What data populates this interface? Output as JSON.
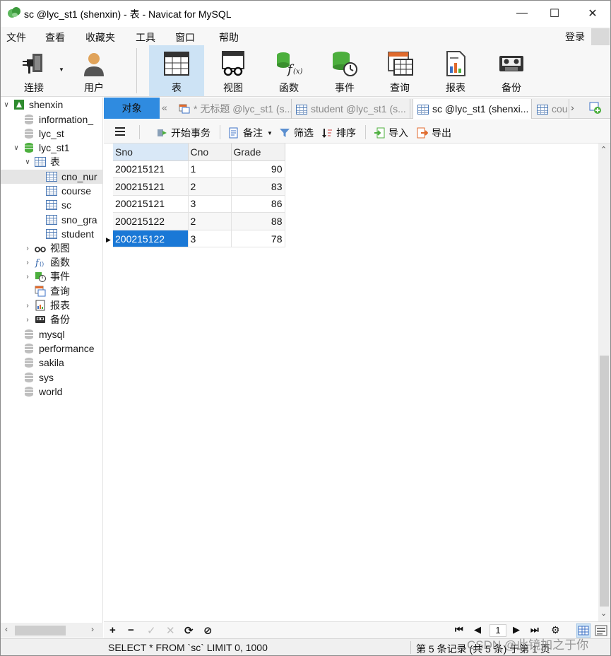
{
  "window": {
    "title": "sc @lyc_st1 (shenxin) - 表 - Navicat for MySQL",
    "controls": {
      "minimize": "—",
      "maximize": "☐",
      "close": "✕"
    }
  },
  "menu": {
    "items": [
      "文件",
      "查看",
      "收藏夹",
      "工具",
      "窗口",
      "帮助"
    ],
    "login": "登录"
  },
  "toolbar": {
    "items": [
      {
        "label": "连接",
        "icon": "plug-icon"
      },
      {
        "label": "用户",
        "icon": "user-icon"
      },
      {
        "label": "表",
        "icon": "table-icon",
        "active": true
      },
      {
        "label": "视图",
        "icon": "view-glasses-icon"
      },
      {
        "label": "函数",
        "icon": "function-icon"
      },
      {
        "label": "事件",
        "icon": "event-clock-icon"
      },
      {
        "label": "查询",
        "icon": "query-icon"
      },
      {
        "label": "报表",
        "icon": "report-icon"
      },
      {
        "label": "备份",
        "icon": "backup-tape-icon"
      }
    ]
  },
  "nav": {
    "connection": "shenxin",
    "databases": [
      "information_",
      "lyc_st",
      "lyc_st1"
    ],
    "lyc_st1": {
      "tables_label": "表",
      "tables": [
        "cno_nur",
        "course",
        "sc",
        "sno_gra",
        "student"
      ],
      "groups": [
        "视图",
        "函数",
        "事件",
        "查询",
        "报表",
        "备份"
      ]
    },
    "other_databases": [
      "mysql",
      "performance",
      "sakila",
      "sys",
      "world"
    ]
  },
  "tabs": {
    "objects": "对象",
    "items": [
      {
        "label": "* 无标题 @lyc_st1 (s...",
        "active": false
      },
      {
        "label": "student @lyc_st1 (s...",
        "active": false
      },
      {
        "label": "sc @lyc_st1 (shenxi...",
        "active": true
      },
      {
        "label": "cou",
        "active": false
      }
    ]
  },
  "gridbar": {
    "begin_transaction": "开始事务",
    "note": "备注",
    "filter": "筛选",
    "sort": "排序",
    "import": "导入",
    "export": "导出"
  },
  "grid": {
    "columns": [
      "Sno",
      "Cno",
      "Grade"
    ],
    "rows": [
      [
        "200215121",
        "1",
        "90"
      ],
      [
        "200215121",
        "2",
        "83"
      ],
      [
        "200215121",
        "3",
        "86"
      ],
      [
        "200215122",
        "2",
        "88"
      ],
      [
        "200215122",
        "3",
        "78"
      ]
    ],
    "selected_row": 4
  },
  "recbar": {
    "add": "+",
    "delete": "−",
    "apply": "✓",
    "discard": "✕",
    "refresh": "⟳",
    "stop": "⊘",
    "first": "⏮",
    "prev": "◀",
    "page": "1",
    "next": "▶",
    "last": "⏭",
    "settings": "⚙"
  },
  "status": {
    "sql": "SELECT * FROM `sc` LIMIT 0, 1000",
    "records": "第 5 条记录 (共 5 条) 于第 1 页"
  },
  "watermark": "CSDN @此镜加之于你",
  "colors": {
    "accent": "#2f8be0",
    "selection": "#1a78d6",
    "toolbar_active": "#cde3f5",
    "db_active": "#4caf3d"
  }
}
